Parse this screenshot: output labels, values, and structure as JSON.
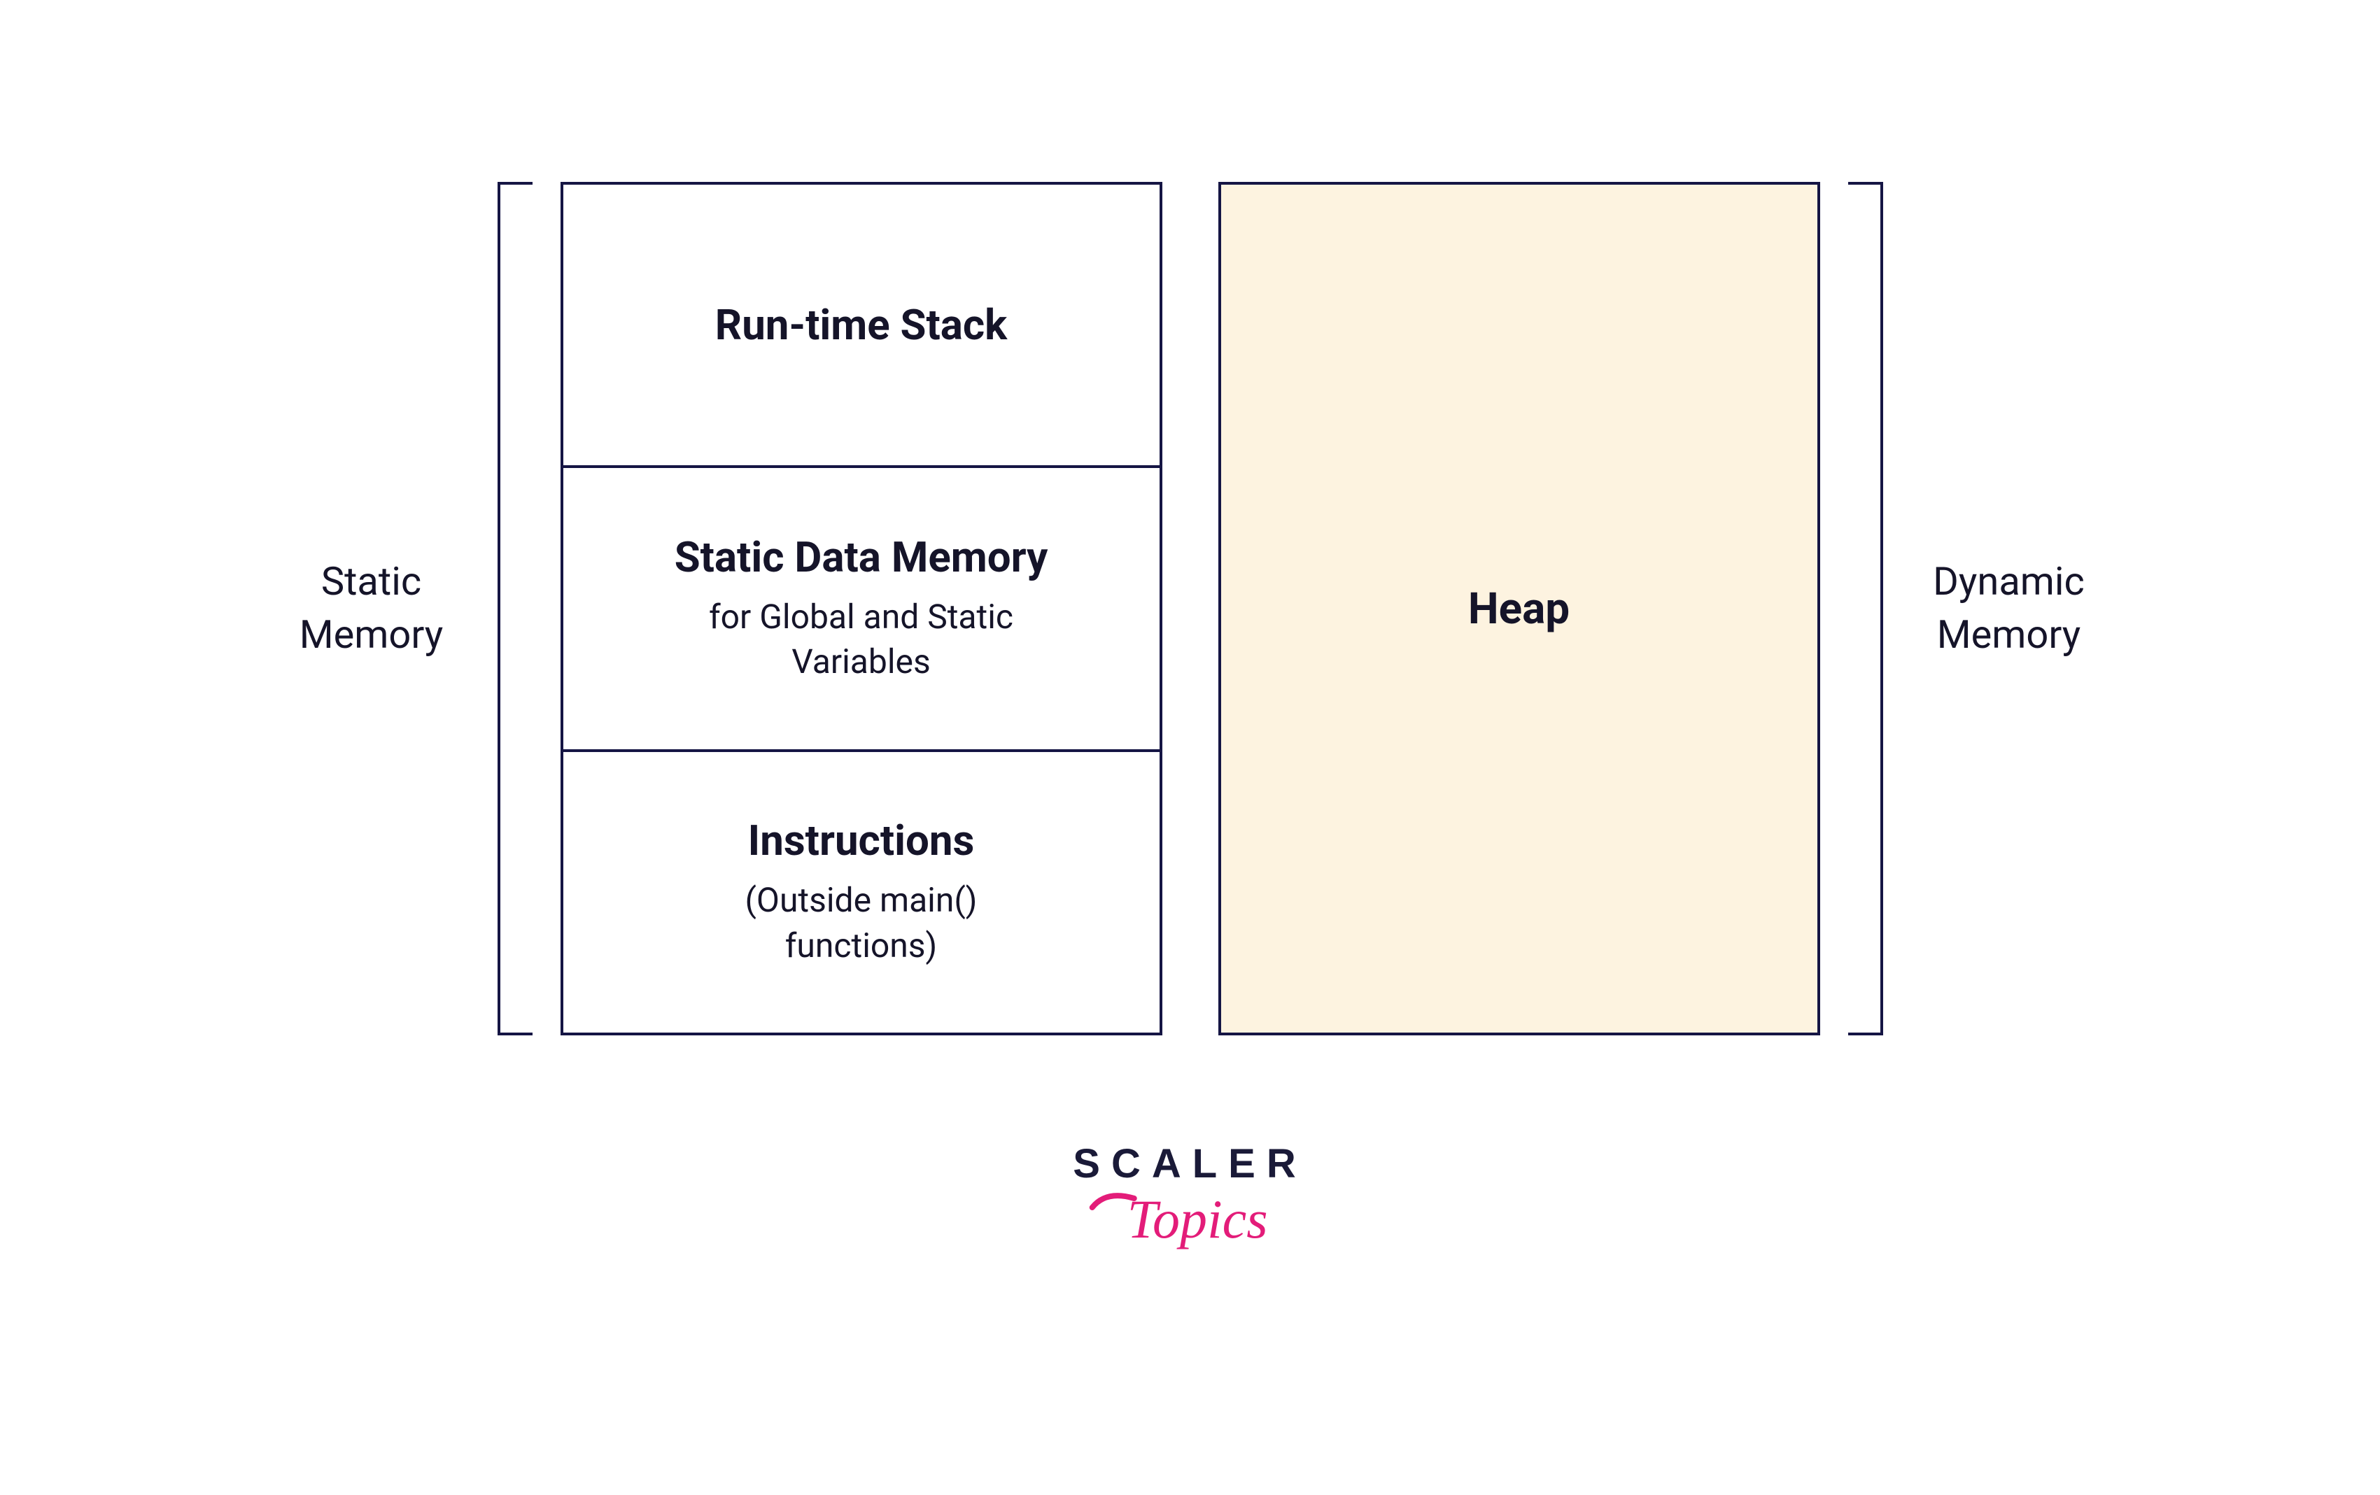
{
  "left_label_line1": "Static",
  "left_label_line2": "Memory",
  "right_label_line1": "Dynamic",
  "right_label_line2": "Memory",
  "static_col": {
    "seg1": {
      "title": "Run-time Stack"
    },
    "seg2": {
      "title": "Static Data Memory",
      "sub_line1": "for Global and Static",
      "sub_line2": "Variables"
    },
    "seg3": {
      "title": "Instructions",
      "sub_line1": "(Outside main()",
      "sub_line2": "functions)"
    }
  },
  "heap": {
    "title": "Heap"
  },
  "logo": {
    "word1": "SCALER",
    "word2": "Topics"
  }
}
